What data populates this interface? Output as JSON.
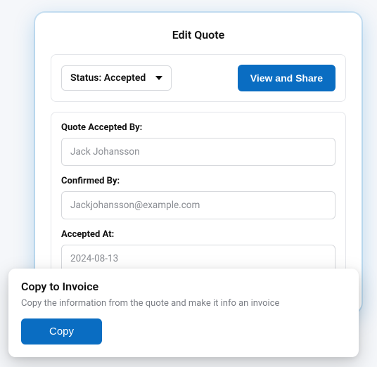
{
  "header": {
    "title": "Edit Quote"
  },
  "top": {
    "status_label": "Status: Accepted",
    "view_share_label": "View and Share"
  },
  "form": {
    "accepted_by_label": "Quote Accepted By:",
    "accepted_by_value": "Jack Johansson",
    "confirmed_by_label": "Confirmed By:",
    "confirmed_by_value": "Jackjohansson@example.com",
    "accepted_at_label": "Accepted At:",
    "accepted_at_value": "2024-08-13"
  },
  "copy_card": {
    "title": "Copy to Invoice",
    "description": "Copy the information from the quote and make it info an invoice",
    "button_label": "Copy"
  }
}
